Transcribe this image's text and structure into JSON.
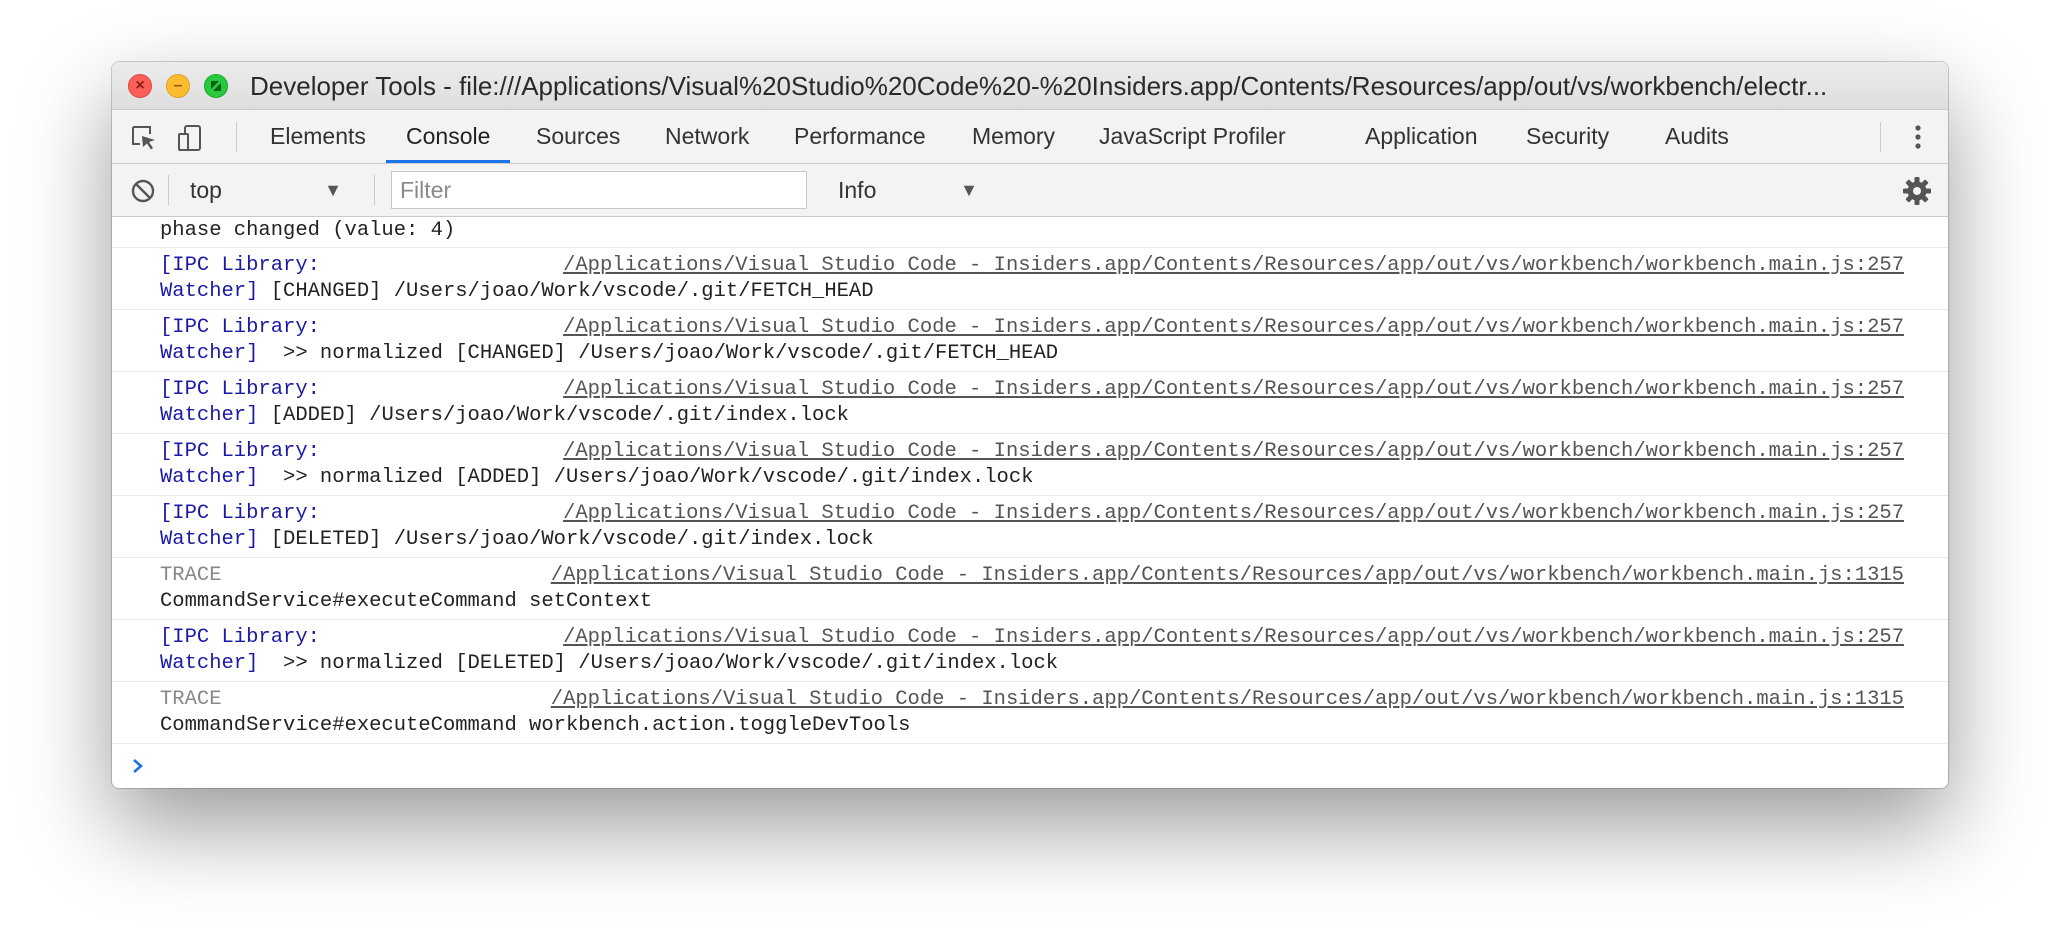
{
  "window": {
    "title": "Developer Tools - file:///Applications/Visual%20Studio%20Code%20-%20Insiders.app/Contents/Resources/app/out/vs/workbench/electr..."
  },
  "tabs": [
    {
      "label": "Elements"
    },
    {
      "label": "Console",
      "active": true
    },
    {
      "label": "Sources"
    },
    {
      "label": "Network"
    },
    {
      "label": "Performance"
    },
    {
      "label": "Memory"
    },
    {
      "label": "JavaScript Profiler"
    },
    {
      "label": "Application"
    },
    {
      "label": "Security"
    },
    {
      "label": "Audits"
    }
  ],
  "toolbar": {
    "context": "top",
    "filter_placeholder": "Filter",
    "level": "Info"
  },
  "console": {
    "top_line": "phase changed (value: 4)",
    "messages": [
      {
        "tag": "[IPC Library:",
        "tag2": "Watcher]",
        "text": " [CHANGED] /Users/joao/Work/vscode/.git/FETCH_HEAD",
        "source": "/Applications/Visual Studio Code - Insiders.app/Contents/Resources/app/out/vs/workbench/workbench.main.js:257"
      },
      {
        "tag": "[IPC Library:",
        "tag2": "Watcher]",
        "text": "  >> normalized [CHANGED] /Users/joao/Work/vscode/.git/FETCH_HEAD",
        "source": "/Applications/Visual Studio Code - Insiders.app/Contents/Resources/app/out/vs/workbench/workbench.main.js:257"
      },
      {
        "tag": "[IPC Library:",
        "tag2": "Watcher]",
        "text": " [ADDED] /Users/joao/Work/vscode/.git/index.lock",
        "source": "/Applications/Visual Studio Code - Insiders.app/Contents/Resources/app/out/vs/workbench/workbench.main.js:257"
      },
      {
        "tag": "[IPC Library:",
        "tag2": "Watcher]",
        "text": "  >> normalized [ADDED] /Users/joao/Work/vscode/.git/index.lock",
        "source": "/Applications/Visual Studio Code - Insiders.app/Contents/Resources/app/out/vs/workbench/workbench.main.js:257"
      },
      {
        "tag": "[IPC Library:",
        "tag2": "Watcher]",
        "text": " [DELETED] /Users/joao/Work/vscode/.git/index.lock",
        "source": "/Applications/Visual Studio Code - Insiders.app/Contents/Resources/app/out/vs/workbench/workbench.main.js:257"
      },
      {
        "tag": "TRACE",
        "text2": "CommandService#executeCommand setContext",
        "source": "/Applications/Visual Studio Code - Insiders.app/Contents/Resources/app/out/vs/workbench/workbench.main.js:1315"
      },
      {
        "tag": "[IPC Library:",
        "tag2": "Watcher]",
        "text": "  >> normalized [DELETED] /Users/joao/Work/vscode/.git/index.lock",
        "source": "/Applications/Visual Studio Code - Insiders.app/Contents/Resources/app/out/vs/workbench/workbench.main.js:257"
      },
      {
        "tag": "TRACE",
        "text2": "CommandService#executeCommand workbench.action.toggleDevTools",
        "source": "/Applications/Visual Studio Code - Insiders.app/Contents/Resources/app/out/vs/workbench/workbench.main.js:1315"
      }
    ]
  },
  "icons": {
    "close": "close-icon",
    "minimize": "minimize-icon",
    "maximize": "maximize-icon",
    "inspect": "inspect-element-icon",
    "device": "device-toolbar-icon",
    "more": "more-vertical-icon",
    "clear": "clear-console-icon",
    "settings": "gear-icon",
    "prompt": "chevron-right-icon"
  },
  "colors": {
    "accent": "#1a73e8",
    "ipc_tag": "#1a1aa6",
    "trace_tag": "#888888"
  }
}
